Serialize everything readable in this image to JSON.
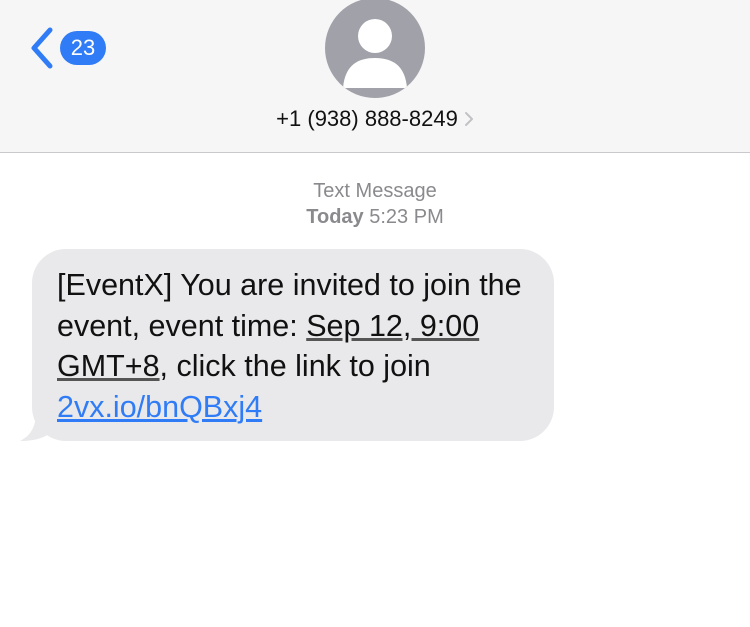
{
  "header": {
    "unread_count": "23",
    "contact_number": "+1 (938) 888-8249"
  },
  "conversation": {
    "service_label": "Text Message",
    "day": "Today",
    "time": "5:23 PM"
  },
  "message": {
    "text_intro": "[EventX] You are invited to join the event, event time: ",
    "event_time": "Sep 12, 9:00 GMT+8",
    "text_middle": ", click the link to join ",
    "link": "2vx.io/bnQBxj4"
  },
  "colors": {
    "accent": "#2f7cf6",
    "bubble": "#e9e9eb",
    "header_bg": "#f6f6f6",
    "avatar": "#a1a2a9",
    "meta_text": "#8a8a8e"
  },
  "icons": {
    "back": "chevron-left-icon",
    "avatar": "person-silhouette-icon",
    "contact_details": "chevron-right-icon"
  }
}
